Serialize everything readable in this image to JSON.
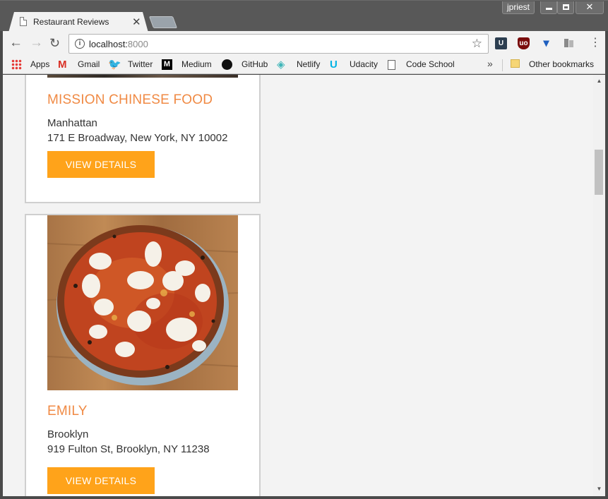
{
  "window": {
    "user": "jpriest"
  },
  "tab": {
    "title": "Restaurant Reviews",
    "close_glyph": "✕"
  },
  "toolbar": {
    "url_host": "localhost:",
    "url_port": "8000"
  },
  "bookmarks": {
    "items": [
      {
        "label": "Apps",
        "icon": "apps-grid-icon"
      },
      {
        "label": "Gmail",
        "icon": "gmail-icon"
      },
      {
        "label": "Twitter",
        "icon": "twitter-icon"
      },
      {
        "label": "Medium",
        "icon": "medium-icon"
      },
      {
        "label": "GitHub",
        "icon": "github-icon"
      },
      {
        "label": "Netlify",
        "icon": "netlify-icon"
      },
      {
        "label": "Udacity",
        "icon": "udacity-icon"
      },
      {
        "label": "Code School",
        "icon": "page-icon"
      }
    ],
    "overflow": "»",
    "other": "Other bookmarks"
  },
  "restaurants": [
    {
      "name": "MISSION CHINESE FOOD",
      "neighborhood": "Manhattan",
      "address": "171 E Broadway, New York, NY 10002",
      "button": "VIEW DETAILS"
    },
    {
      "name": "EMILY",
      "neighborhood": "Brooklyn",
      "address": "919 Fulton St, Brooklyn, NY 11238",
      "button": "VIEW DETAILS"
    }
  ],
  "colors": {
    "accent_title": "#f08a44",
    "button_bg": "#ffa31a",
    "chrome_dark": "#585858"
  }
}
